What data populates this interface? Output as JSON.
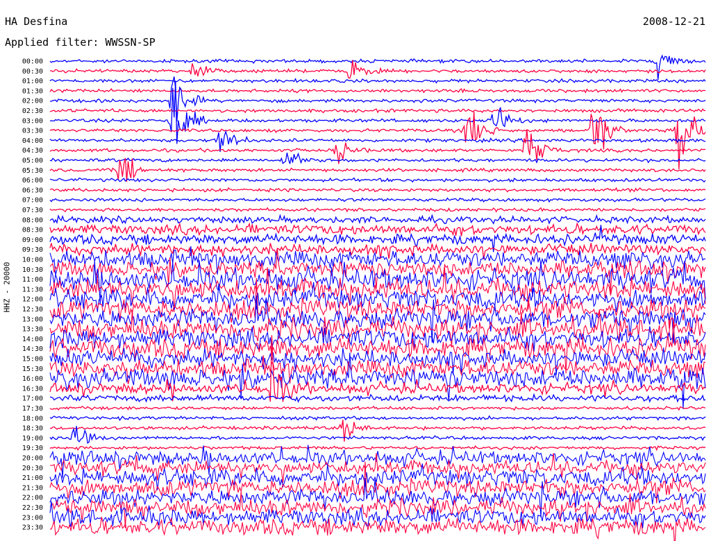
{
  "header": {
    "station": "HA Desfina",
    "date": "2008-12-21",
    "filter": "Applied filter: WWSSN-SP",
    "channel": "HHZ - 20000"
  },
  "chart_data": {
    "type": "line",
    "title": "HA Desfina",
    "date": "2008-12-21",
    "filter": "WWSSN-SP",
    "ylabel": "HHZ - 20000",
    "row_labels": [
      "00:00",
      "00:30",
      "01:00",
      "01:30",
      "02:00",
      "02:30",
      "03:00",
      "03:30",
      "04:00",
      "04:30",
      "05:00",
      "05:30",
      "06:00",
      "06:30",
      "07:00",
      "07:30",
      "08:00",
      "08:30",
      "09:00",
      "09:30",
      "10:00",
      "10:30",
      "11:00",
      "11:30",
      "12:00",
      "12:30",
      "13:00",
      "13:30",
      "14:00",
      "14:30",
      "15:00",
      "15:30",
      "16:00",
      "16:30",
      "17:00",
      "17:30",
      "18:00",
      "18:30",
      "19:00",
      "19:30",
      "20:00",
      "20:30",
      "21:00",
      "21:30",
      "22:00",
      "22:30",
      "23:00",
      "23:30"
    ],
    "row_minutes": 30,
    "series_colors": [
      "#0000ff",
      "#ff0040"
    ],
    "amplitude_profile": [
      1,
      1,
      1,
      1,
      1,
      1,
      1,
      1,
      1,
      1,
      1,
      1,
      1,
      1,
      1,
      1,
      2,
      3,
      3,
      3,
      5,
      5,
      6,
      6,
      6,
      6,
      6,
      6,
      6,
      6,
      5,
      5,
      6,
      3,
      2,
      1,
      1,
      1,
      1,
      1,
      4,
      4,
      5,
      5,
      5,
      5,
      5,
      5
    ],
    "events": [
      {
        "row": 0,
        "pos": 0.93,
        "amp": 3
      },
      {
        "row": 1,
        "pos": 0.46,
        "amp": 2
      },
      {
        "row": 1,
        "pos": 0.22,
        "amp": 1.5
      },
      {
        "row": 4,
        "pos": 0.19,
        "amp": 5
      },
      {
        "row": 6,
        "pos": 0.19,
        "amp": 8
      },
      {
        "row": 6,
        "pos": 0.68,
        "amp": 3
      },
      {
        "row": 7,
        "pos": 0.64,
        "amp": 5
      },
      {
        "row": 7,
        "pos": 0.83,
        "amp": 7
      },
      {
        "row": 7,
        "pos": 0.96,
        "amp": 8
      },
      {
        "row": 8,
        "pos": 0.26,
        "amp": 3
      },
      {
        "row": 9,
        "pos": 0.44,
        "amp": 2
      },
      {
        "row": 9,
        "pos": 0.73,
        "amp": 5
      },
      {
        "row": 10,
        "pos": 0.36,
        "amp": 2
      },
      {
        "row": 11,
        "pos": 0.11,
        "amp": 4
      },
      {
        "row": 33,
        "pos": 0.34,
        "amp": 4
      },
      {
        "row": 37,
        "pos": 0.45,
        "amp": 2
      },
      {
        "row": 38,
        "pos": 0.04,
        "amp": 2
      }
    ]
  }
}
